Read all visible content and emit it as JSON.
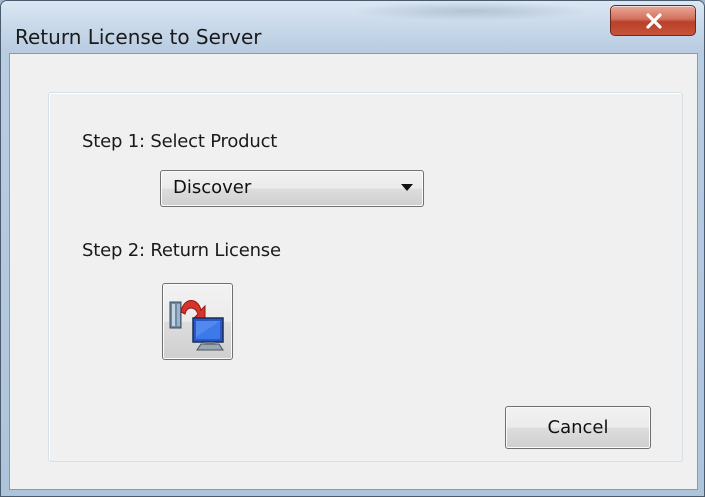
{
  "window": {
    "title": "Return License to Server",
    "close_icon": "close-icon"
  },
  "step1": {
    "label": "Step 1: Select Product",
    "product_select": {
      "selected": "Discover",
      "icon": "chevron-down-icon"
    }
  },
  "step2": {
    "label": "Step 2: Return License",
    "return_button_icon": "return-license-icon"
  },
  "buttons": {
    "cancel_label": "Cancel"
  },
  "colors": {
    "title_bar": "#c6d7e9",
    "close_button": "#c8533b",
    "client_background": "#f0f0f0"
  }
}
